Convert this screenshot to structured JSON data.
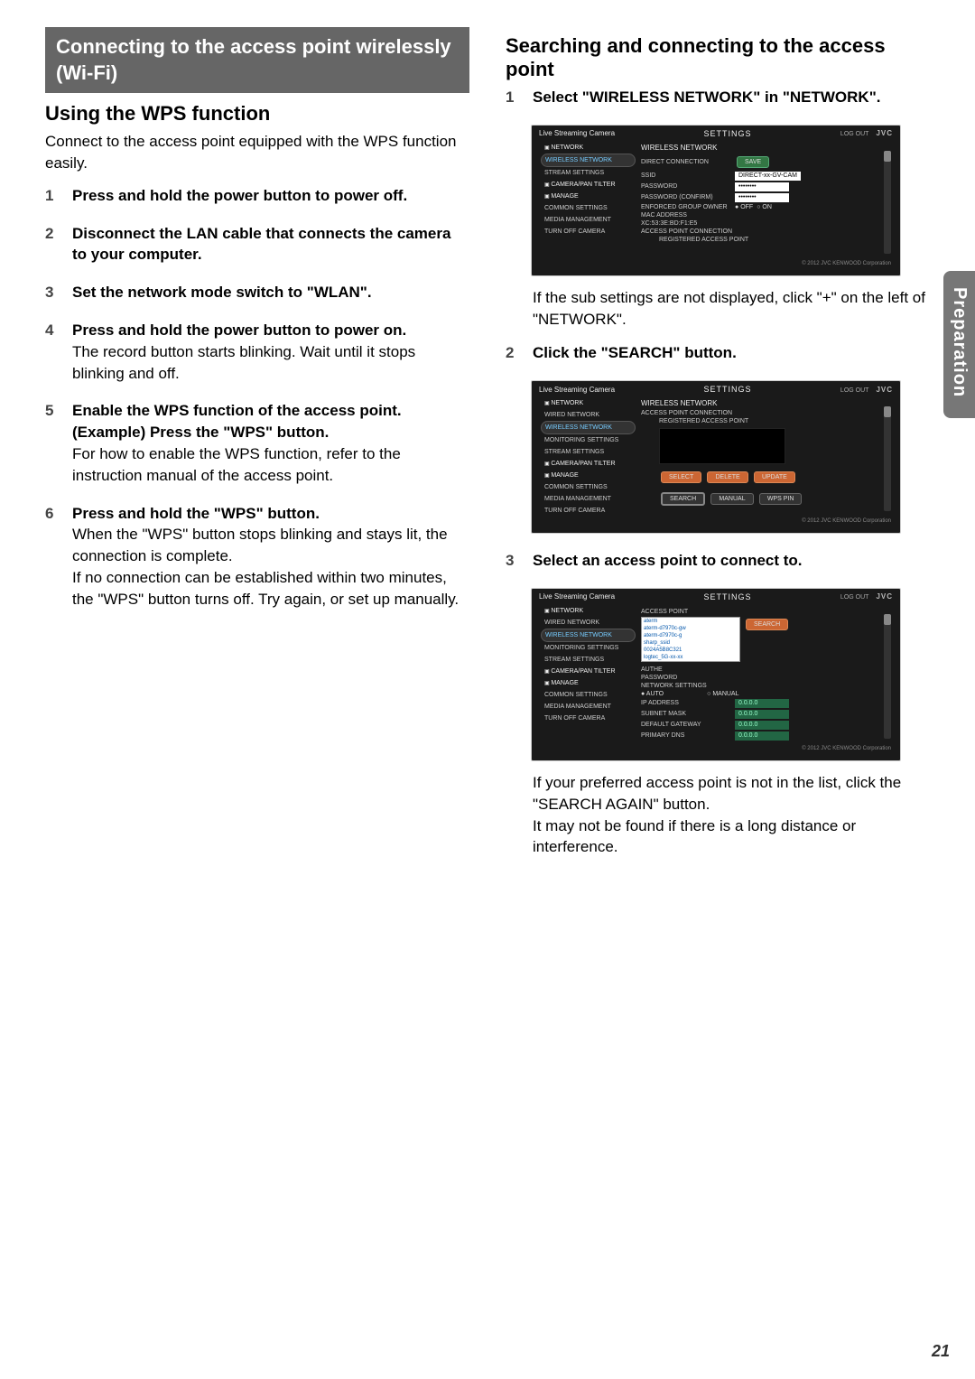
{
  "sideTab": "Preparation",
  "pageNumber": "21",
  "left": {
    "sectionHeading": "Connecting to the access point wirelessly (Wi-Fi)",
    "h2": "Using the WPS function",
    "intro": "Connect to the access point equipped with the WPS function easily.",
    "steps": [
      {
        "n": "1",
        "title": "Press and hold the power button to power off."
      },
      {
        "n": "2",
        "title": "Disconnect the LAN cable that connects the camera to your computer."
      },
      {
        "n": "3",
        "title": "Set the network mode switch to \"WLAN\"."
      },
      {
        "n": "4",
        "title": "Press and hold the power button to power on.",
        "desc": "The record button starts blinking. Wait until it stops blinking and off."
      },
      {
        "n": "5",
        "title": "Enable the WPS function of the access point. (Example) Press the \"WPS\" button.",
        "desc": "For how to enable the WPS function, refer to the instruction manual of the access point."
      },
      {
        "n": "6",
        "title": "Press and hold the \"WPS\" button.",
        "desc": "When the \"WPS\" button stops blinking and stays lit, the connection is complete.\nIf no connection can be established within two minutes, the \"WPS\" button turns off. Try again, or set up manually."
      }
    ]
  },
  "right": {
    "h2": "Searching and connecting to the access point",
    "steps": [
      {
        "n": "1",
        "title": "Select \"WIRELESS NETWORK\" in \"NETWORK\".",
        "after": "If the sub settings are not displayed, click \"+\" on the left of \"NETWORK\"."
      },
      {
        "n": "2",
        "title": "Click the \"SEARCH\" button."
      },
      {
        "n": "3",
        "title": "Select an access point to connect to.",
        "after": "If your preferred access point is not in the list, click the \"SEARCH AGAIN\" button.\nIt may not be found if there is a long distance or interference."
      }
    ]
  },
  "shot": {
    "appTitle": "Live Streaming Camera",
    "headerTitle": "SETTINGS",
    "logout": "LOG OUT",
    "brand": "JVC",
    "copyright": "© 2012 JVC KENWOOD Corporation",
    "sidebarFull": [
      "NETWORK",
      "WIRED NETWORK",
      "WIRELESS NETWORK",
      "MONITORING SETTINGS",
      "STREAM SETTINGS",
      "CAMERA/PAN TILTER",
      "MANAGE",
      "COMMON SETTINGS",
      "MEDIA MANAGEMENT",
      "TURN OFF CAMERA"
    ],
    "sidebarShort": [
      "NETWORK",
      "WIRELESS NETWORK",
      "STREAM SETTINGS",
      "CAMERA/PAN TILTER",
      "MANAGE",
      "COMMON SETTINGS",
      "MEDIA MANAGEMENT",
      "TURN OFF CAMERA"
    ],
    "panel1": {
      "title": "WIRELESS NETWORK",
      "rows": {
        "directConn": "DIRECT CONNECTION",
        "ssid": "SSID",
        "ssidVal": "DIRECT-xx-GV-CAM",
        "password": "PASSWORD",
        "passwordVal": "••••••••",
        "passwordConfirm": "PASSWORD (CONFIRM)",
        "passwordConfirmVal": "••••••••",
        "ego": "ENFORCED GROUP OWNER",
        "off": "OFF",
        "on": "ON",
        "mac": "MAC ADDRESS",
        "macVal": "XC:53:3E:BD:F1:E5",
        "apc": "ACCESS POINT CONNECTION",
        "rap": "REGISTERED ACCESS POINT"
      },
      "saveBtn": "SAVE"
    },
    "panel2": {
      "title": "WIRELESS NETWORK",
      "apc": "ACCESS POINT CONNECTION",
      "rap": "REGISTERED ACCESS POINT",
      "buttons": {
        "select": "SELECT",
        "delete": "DELETE",
        "update": "UPDATE",
        "search": "SEARCH",
        "manual": "MANUAL",
        "wpspin": "WPS PIN"
      }
    },
    "panel3": {
      "apsLabel": "ACCESS POINT",
      "aps": [
        "aterm",
        "aterm-d7970c-gw",
        "aterm-d7970c-g",
        "sharp_ssid",
        "0024A5B8C321",
        "logtec_5G-xx-xx"
      ],
      "searchBtn": "SEARCH",
      "authe": "AUTHE",
      "password": "PASSWORD",
      "netset": "NETWORK SETTINGS",
      "auto": "AUTO",
      "manual": "MANUAL",
      "ip": "IP ADDRESS",
      "subnet": "SUBNET MASK",
      "gw": "DEFAULT GATEWAY",
      "dns": "PRIMARY DNS",
      "zeros": "0.0.0.0"
    }
  }
}
